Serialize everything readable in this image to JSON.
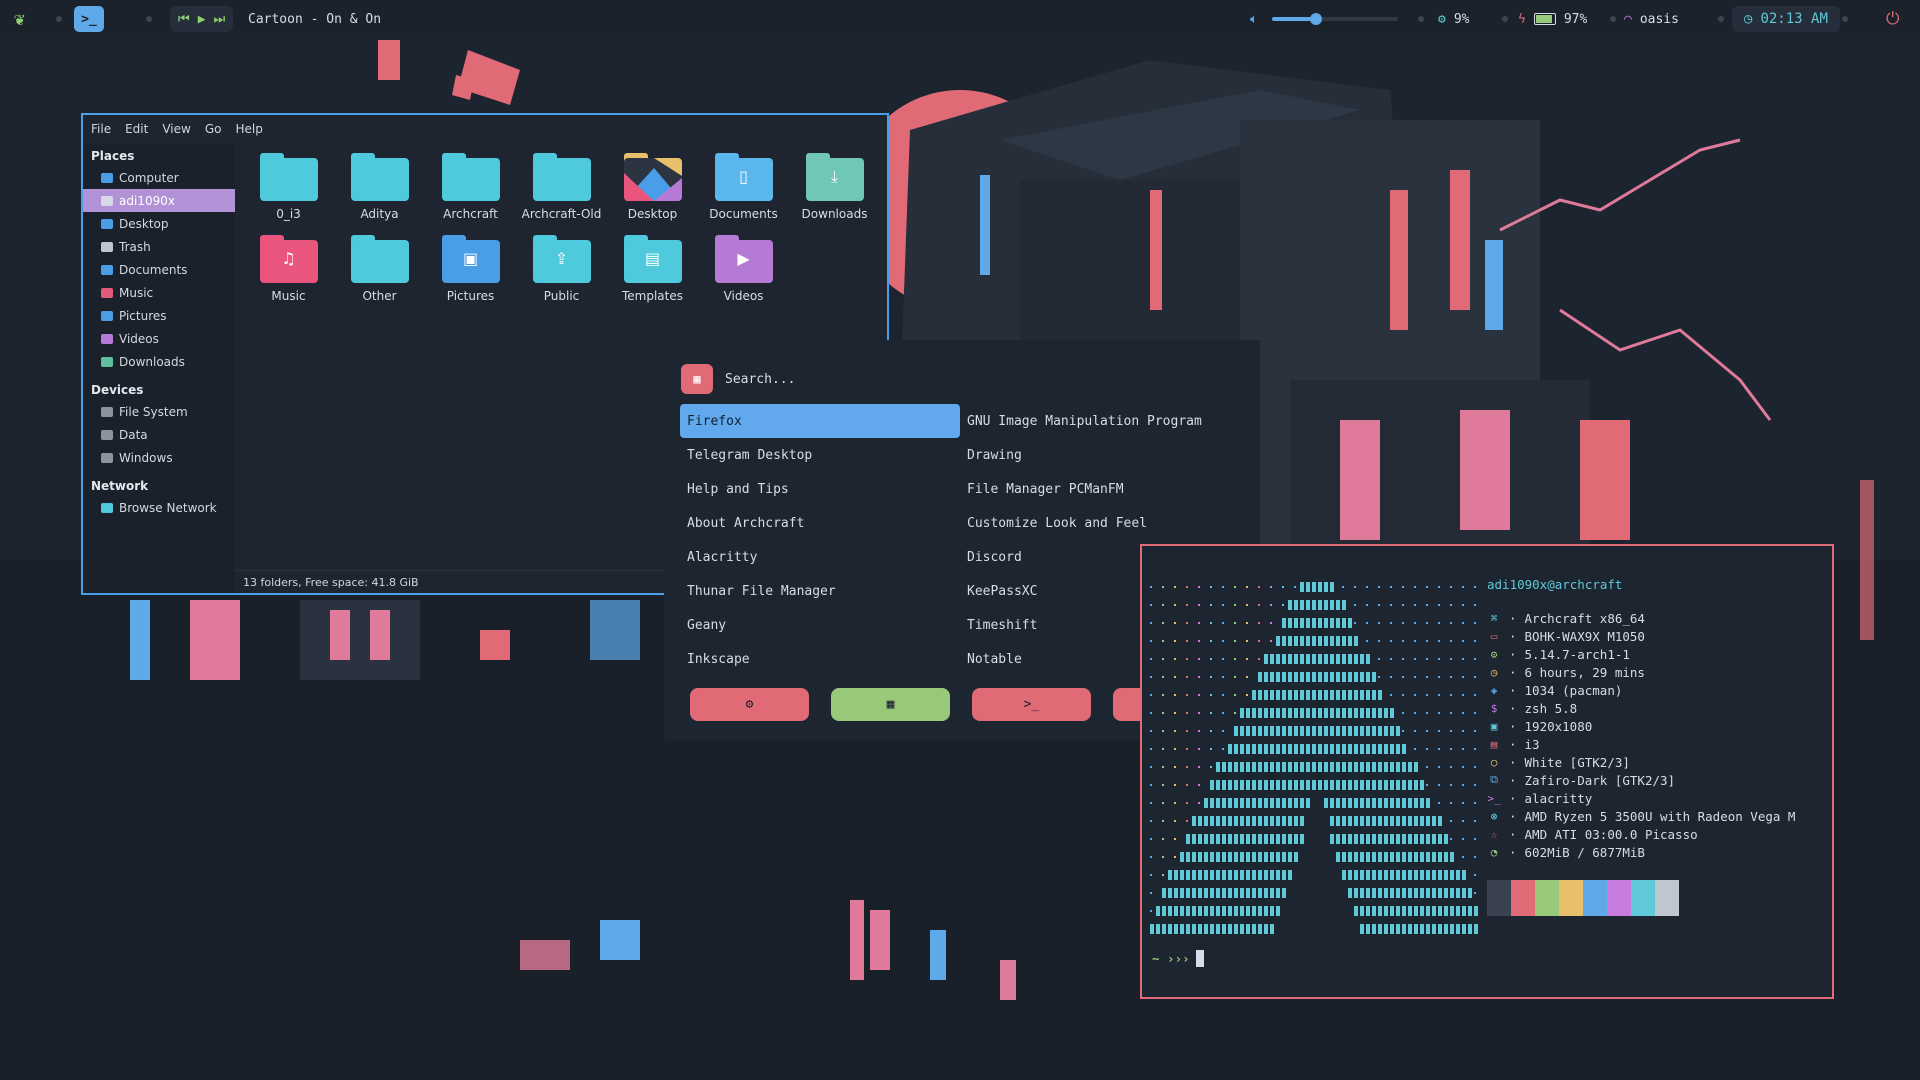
{
  "topbar": {
    "now_playing": "Cartoon - On & On",
    "volume_level": 0.35,
    "cpu": "9%",
    "battery": "97%",
    "wifi": "oasis",
    "clock": "02:13 AM",
    "icons": [
      "leaf-logo-icon",
      "terminal-icon",
      "prev-icon",
      "play-icon",
      "next-icon",
      "volume-icon",
      "cpu-icon",
      "battery-icon",
      "wifi-icon",
      "clock-icon",
      "power-icon"
    ]
  },
  "file_manager": {
    "menu": [
      "File",
      "Edit",
      "View",
      "Go",
      "Help"
    ],
    "places_header": "Places",
    "places": [
      {
        "label": "Computer",
        "color": "#4a9ee8"
      },
      {
        "label": "adi1090x",
        "color": "#d8d8e8",
        "selected": true
      },
      {
        "label": "Desktop",
        "color": "#4a9ee8"
      },
      {
        "label": "Trash",
        "color": "#c0c6cf"
      },
      {
        "label": "Documents",
        "color": "#4a9ee8"
      },
      {
        "label": "Music",
        "color": "#e05a7a"
      },
      {
        "label": "Pictures",
        "color": "#4a9ee8"
      },
      {
        "label": "Videos",
        "color": "#b67bd8"
      },
      {
        "label": "Downloads",
        "color": "#5fbf9f"
      }
    ],
    "devices_header": "Devices",
    "devices": [
      "File System",
      "Data",
      "Windows"
    ],
    "network_header": "Network",
    "network": [
      "Browse Network"
    ],
    "folders": [
      {
        "label": "0_i3",
        "color": "#4fc9dc",
        "glyph": ""
      },
      {
        "label": "Aditya",
        "color": "#4fc9dc",
        "glyph": ""
      },
      {
        "label": "Archcraft",
        "color": "#4fc9dc",
        "glyph": ""
      },
      {
        "label": "Archcraft-Old",
        "color": "#4fc9dc",
        "glyph": ""
      },
      {
        "label": "Desktop",
        "color": "#2b3440",
        "glyph": "desktop"
      },
      {
        "label": "Documents",
        "color": "#5bb6ec",
        "glyph": "▯"
      },
      {
        "label": "Downloads",
        "color": "#6fc7b7",
        "glyph": "⤓"
      },
      {
        "label": "Music",
        "color": "#e9557c",
        "glyph": "♫"
      },
      {
        "label": "Other",
        "color": "#4fc9dc",
        "glyph": ""
      },
      {
        "label": "Pictures",
        "color": "#4a9ee8",
        "glyph": "▣"
      },
      {
        "label": "Public",
        "color": "#4fc9dc",
        "glyph": "⇪"
      },
      {
        "label": "Templates",
        "color": "#4fc9dc",
        "glyph": "▤"
      },
      {
        "label": "Videos",
        "color": "#b679d6",
        "glyph": "▶"
      }
    ],
    "status": "13 folders, Free space: 41.8 GiB"
  },
  "launcher": {
    "placeholder": "Search...",
    "items": [
      "Firefox",
      "GNU Image Manipulation Program",
      "Telegram Desktop",
      "Drawing",
      "Help and Tips",
      "File Manager PCManFM",
      "About Archcraft",
      "Customize Look and Feel",
      "Alacritty",
      "Discord",
      "Thunar File Manager",
      "KeePassXC",
      "Geany",
      "Timeshift",
      "Inkscape",
      "Notable"
    ],
    "selected": "Firefox",
    "buttons": [
      {
        "name": "settings-mode-button",
        "icon": "⚙",
        "color": "#e06b76"
      },
      {
        "name": "apps-mode-button",
        "icon": "▦",
        "color": "#98c97a"
      },
      {
        "name": "run-mode-button",
        "icon": ">_",
        "color": "#e06b76"
      },
      {
        "name": "windows-mode-button",
        "icon": "⋮⋮⋮",
        "color": "#e06b76"
      }
    ]
  },
  "terminal": {
    "user_host": "adi1090x@archcraft",
    "info": [
      {
        "icon": "⌘",
        "color": "#5fc9d8",
        "text": "Archcraft x86_64"
      },
      {
        "icon": "▭",
        "color": "#e06b76",
        "text": "BOHK-WAX9X M1050"
      },
      {
        "icon": "⚙",
        "color": "#98c97a",
        "text": "5.14.7-arch1-1"
      },
      {
        "icon": "◷",
        "color": "#e8c06b",
        "text": "6 hours, 29 mins"
      },
      {
        "icon": "◈",
        "color": "#5fa9e8",
        "text": "1034 (pacman)"
      },
      {
        "icon": "$",
        "color": "#c77de0",
        "text": "zsh 5.8"
      },
      {
        "icon": "▣",
        "color": "#5fc9d8",
        "text": "1920x1080"
      },
      {
        "icon": "▤",
        "color": "#e06b76",
        "text": "i3"
      },
      {
        "icon": "○",
        "color": "#e8c06b",
        "text": "White [GTK2/3]"
      },
      {
        "icon": "⧉",
        "color": "#5fa9e8",
        "text": "Zafiro-Dark [GTK2/3]"
      },
      {
        "icon": ">_",
        "color": "#c77de0",
        "text": "alacritty"
      },
      {
        "icon": "⊛",
        "color": "#5fc9d8",
        "text": "AMD Ryzen 5 3500U with Radeon Vega M"
      },
      {
        "icon": "☆",
        "color": "#e06b76",
        "text": "AMD ATI 03:00.0 Picasso"
      },
      {
        "icon": "◔",
        "color": "#98c97a",
        "text": "602MiB / 6877MiB"
      }
    ],
    "palette": [
      "#3a4250",
      "#e06b76",
      "#98c97a",
      "#e8c06b",
      "#5fa9e8",
      "#c77de0",
      "#5fc9d8",
      "#c0c6cf"
    ],
    "prompt": "~ ›››"
  }
}
